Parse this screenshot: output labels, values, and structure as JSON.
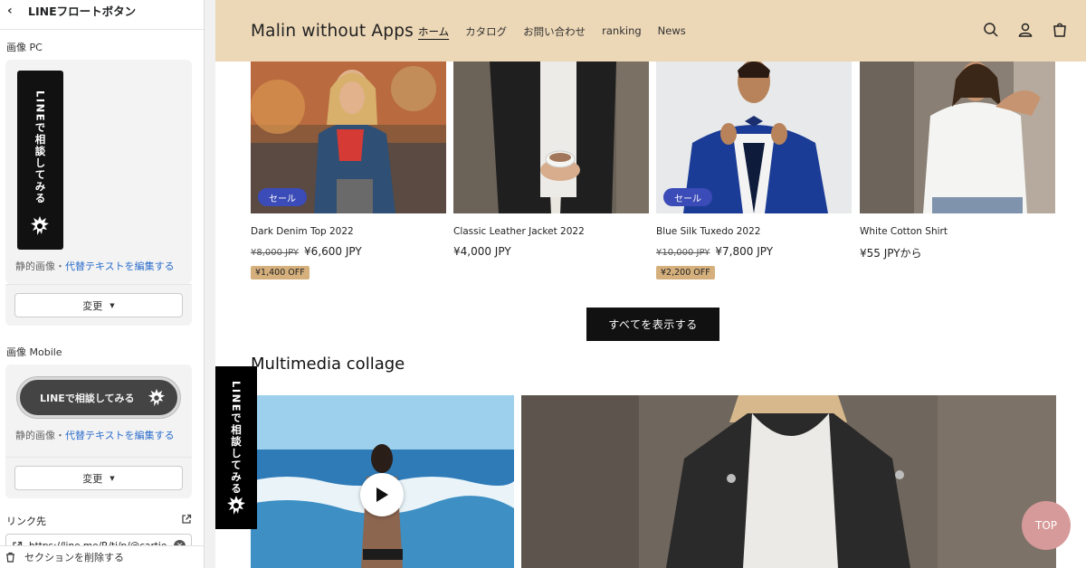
{
  "editor": {
    "title": "LINEフロートボタン",
    "image_pc": {
      "label": "画像 PC",
      "banner_text": "LINEで相談してみる",
      "caption_static": "静的画像・",
      "caption_link": "代替テキストを編集する",
      "change_label": "変更"
    },
    "image_mobile": {
      "label": "画像 Mobile",
      "banner_text": "LINEで相談してみる",
      "caption_static": "静的画像・",
      "caption_link": "代替テキストを編集する",
      "change_label": "変更"
    },
    "link": {
      "label": "リンク先",
      "value": "https://line.me/R/ti/p/@cartie"
    },
    "delete_label": "セクションを削除する"
  },
  "store": {
    "logo": "Malin without Apps",
    "nav": [
      "ホーム",
      "カタログ",
      "お問い合わせ",
      "ranking",
      "News"
    ],
    "products": [
      {
        "name": "Dark Denim Top 2022",
        "old_price": "¥8,000 JPY",
        "price": "¥6,600 JPY",
        "sale_badge": "セール",
        "off_badge": "¥1,400 OFF"
      },
      {
        "name": "Classic Leather Jacket 2022",
        "old_price": "",
        "price": "¥4,000 JPY",
        "sale_badge": "",
        "off_badge": ""
      },
      {
        "name": "Blue Silk Tuxedo 2022",
        "old_price": "¥10,000 JPY",
        "price": "¥7,800 JPY",
        "sale_badge": "セール",
        "off_badge": "¥2,200 OFF"
      },
      {
        "name": "White Cotton Shirt",
        "old_price": "",
        "price": "¥55 JPYから",
        "sale_badge": "",
        "off_badge": ""
      }
    ],
    "view_all": "すべてを表示する",
    "section_title": "Multimedia collage",
    "float_button_text": "LINEで相談してみる",
    "top_button": "TOP"
  },
  "colors": {
    "header_bg": "#ecd7b6",
    "sale_badge": "#3b4bb7",
    "off_badge": "#d5b07d",
    "top_button": "#d79a9a",
    "link": "#2c6ecb"
  },
  "icons": [
    "back-chevron-icon",
    "caret-down-icon",
    "external-link-icon",
    "link-icon",
    "clear-icon",
    "trash-icon",
    "search-icon",
    "account-icon",
    "cart-icon",
    "play-icon",
    "mascot-icon"
  ]
}
